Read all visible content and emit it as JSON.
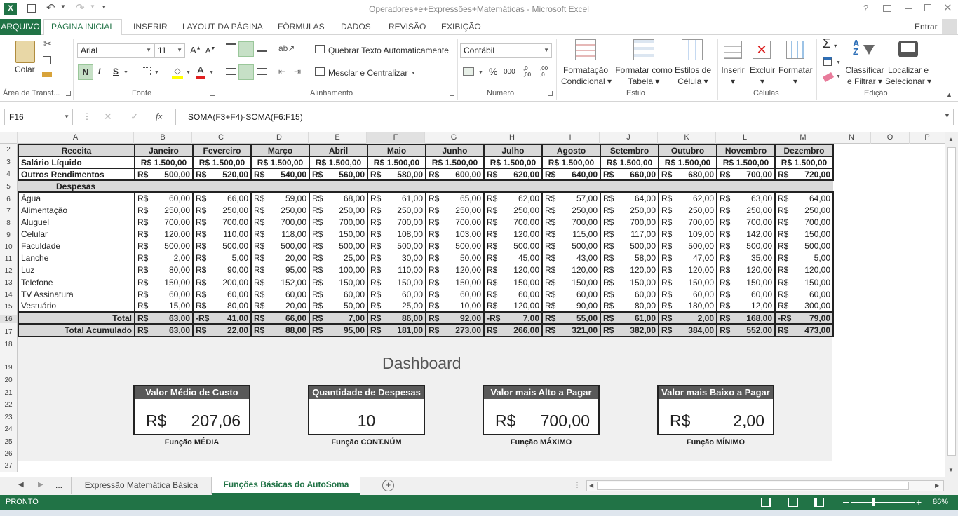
{
  "app": {
    "title": "Operadores+e+Expressões+Matemáticas - Microsoft Excel",
    "excel_logo": "X",
    "signin": "Entrar",
    "help": "?"
  },
  "tabs": [
    "ARQUIVO",
    "PÁGINA INICIAL",
    "INSERIR",
    "LAYOUT DA PÁGINA",
    "FÓRMULAS",
    "DADOS",
    "REVISÃO",
    "EXIBIÇÃO"
  ],
  "ribbon": {
    "clipboard": {
      "paste": "Colar",
      "group": "Área de Transf..."
    },
    "font": {
      "name": "Arial",
      "size": "11",
      "group": "Fonte",
      "bold": "N",
      "italic": "I",
      "underline": "S"
    },
    "alignment": {
      "wrap": "Quebrar Texto Automaticamente",
      "merge": "Mesclar e Centralizar",
      "group": "Alinhamento"
    },
    "number": {
      "format": "Contábil",
      "group": "Número",
      "percent": "%",
      "thousands": "000",
      "inc_dec": ",0 ,00",
      "dec_dec": ",00 ,0"
    },
    "styles": {
      "cond1": "Formatação",
      "cond2": "Condicional",
      "table1": "Formatar como",
      "table2": "Tabela",
      "cell1": "Estilos de",
      "cell2": "Célula",
      "group": "Estilo"
    },
    "cells": {
      "insert": "Inserir",
      "delete": "Excluir",
      "format": "Formatar",
      "group": "Células"
    },
    "editing": {
      "sort1": "Classificar",
      "sort2": "e Filtrar",
      "find1": "Localizar e",
      "find2": "Selecionar",
      "group": "Edição"
    }
  },
  "formula_bar": {
    "name_box": "F16",
    "formula": "=SOMA(F3+F4)-SOMA(F6:F15)",
    "fx": "fx"
  },
  "columns": [
    "A",
    "B",
    "C",
    "D",
    "E",
    "F",
    "G",
    "H",
    "I",
    "J",
    "K",
    "L",
    "M",
    "N",
    "O",
    "P"
  ],
  "rows": [
    "2",
    "3",
    "4",
    "5",
    "6",
    "7",
    "8",
    "9",
    "10",
    "11",
    "12",
    "13",
    "14",
    "15",
    "16",
    "17",
    "18",
    "19",
    "20",
    "21",
    "22",
    "23",
    "24",
    "25",
    "26",
    "27"
  ],
  "sheet": {
    "header": [
      "Receita",
      "Janeiro",
      "Fevereiro",
      "Março",
      "Abril",
      "Maio",
      "Junho",
      "Julho",
      "Agosto",
      "Setembro",
      "Outubro",
      "Novembro",
      "Dezembro"
    ],
    "currency": "R$",
    "salary": {
      "label": "Salário Líquido",
      "values": [
        "R$ 1.500,00",
        "R$ 1.500,00",
        "R$ 1.500,00",
        "R$ 1.500,00",
        "R$ 1.500,00",
        "R$ 1.500,00",
        "R$ 1.500,00",
        "R$ 1.500,00",
        "R$ 1.500,00",
        "R$ 1.500,00",
        "R$ 1.500,00",
        "R$ 1.500,00"
      ]
    },
    "other": {
      "label": "Outros Rendimentos",
      "values": [
        "500,00",
        "520,00",
        "540,00",
        "560,00",
        "580,00",
        "600,00",
        "620,00",
        "640,00",
        "660,00",
        "680,00",
        "700,00",
        "720,00"
      ]
    },
    "expenses_label": "Despesas",
    "expenses": [
      {
        "label": "Água",
        "values": [
          "60,00",
          "66,00",
          "59,00",
          "68,00",
          "61,00",
          "65,00",
          "62,00",
          "57,00",
          "64,00",
          "62,00",
          "63,00",
          "64,00"
        ]
      },
      {
        "label": "Alimentação",
        "values": [
          "250,00",
          "250,00",
          "250,00",
          "250,00",
          "250,00",
          "250,00",
          "250,00",
          "250,00",
          "250,00",
          "250,00",
          "250,00",
          "250,00"
        ]
      },
      {
        "label": "Aluguel",
        "values": [
          "700,00",
          "700,00",
          "700,00",
          "700,00",
          "700,00",
          "700,00",
          "700,00",
          "700,00",
          "700,00",
          "700,00",
          "700,00",
          "700,00"
        ]
      },
      {
        "label": "Celular",
        "values": [
          "120,00",
          "110,00",
          "118,00",
          "150,00",
          "108,00",
          "103,00",
          "120,00",
          "115,00",
          "117,00",
          "109,00",
          "142,00",
          "150,00"
        ]
      },
      {
        "label": "Faculdade",
        "values": [
          "500,00",
          "500,00",
          "500,00",
          "500,00",
          "500,00",
          "500,00",
          "500,00",
          "500,00",
          "500,00",
          "500,00",
          "500,00",
          "500,00"
        ]
      },
      {
        "label": "Lanche",
        "values": [
          "2,00",
          "5,00",
          "20,00",
          "25,00",
          "30,00",
          "50,00",
          "45,00",
          "43,00",
          "58,00",
          "47,00",
          "35,00",
          "5,00"
        ]
      },
      {
        "label": "Luz",
        "values": [
          "80,00",
          "90,00",
          "95,00",
          "100,00",
          "110,00",
          "120,00",
          "120,00",
          "120,00",
          "120,00",
          "120,00",
          "120,00",
          "120,00"
        ]
      },
      {
        "label": "Telefone",
        "values": [
          "150,00",
          "200,00",
          "152,00",
          "150,00",
          "150,00",
          "150,00",
          "150,00",
          "150,00",
          "150,00",
          "150,00",
          "150,00",
          "150,00"
        ]
      },
      {
        "label": "TV Assinatura",
        "values": [
          "60,00",
          "60,00",
          "60,00",
          "60,00",
          "60,00",
          "60,00",
          "60,00",
          "60,00",
          "60,00",
          "60,00",
          "60,00",
          "60,00"
        ]
      },
      {
        "label": "Vestuário",
        "values": [
          "15,00",
          "80,00",
          "20,00",
          "50,00",
          "25,00",
          "10,00",
          "120,00",
          "90,00",
          "80,00",
          "180,00",
          "12,00",
          "300,00"
        ]
      }
    ],
    "total": {
      "label": "Total",
      "cur": [
        "R$",
        "-R$",
        "R$",
        "R$",
        "R$",
        "R$",
        "-R$",
        "R$",
        "R$",
        "R$",
        "R$",
        "-R$"
      ],
      "values": [
        "63,00",
        "41,00",
        "66,00",
        "7,00",
        "86,00",
        "92,00",
        "7,00",
        "55,00",
        "61,00",
        "2,00",
        "168,00",
        "79,00"
      ]
    },
    "accum": {
      "label": "Total Acumulado",
      "values": [
        "63,00",
        "22,00",
        "88,00",
        "95,00",
        "181,00",
        "273,00",
        "266,00",
        "321,00",
        "382,00",
        "384,00",
        "552,00",
        "473,00"
      ]
    }
  },
  "dashboard": {
    "title": "Dashboard",
    "cards": [
      {
        "title": "Valor Médio de Custo",
        "cur": "R$",
        "value": "207,06",
        "fn": "Função MÉDIA"
      },
      {
        "title": "Quantidade de Despesas",
        "cur": "",
        "value": "10",
        "fn": "Função CONT.NÚM"
      },
      {
        "title": "Valor mais Alto a Pagar",
        "cur": "R$",
        "value": "700,00",
        "fn": "Função MÁXIMO"
      },
      {
        "title": "Valor mais Baixo a Pagar",
        "cur": "R$",
        "value": "2,00",
        "fn": "Função MÍNIMO"
      }
    ]
  },
  "sheet_tabs": {
    "ellipsis": "...",
    "tab1": "Expressão Matemática Básica",
    "tab2": "Funções Básicas do AutoSoma"
  },
  "status": {
    "mode": "PRONTO",
    "zoom": "86%"
  },
  "colors": {
    "excel_green": "#217346",
    "header_gray": "#d9d9d9",
    "card_title": "#595959"
  }
}
